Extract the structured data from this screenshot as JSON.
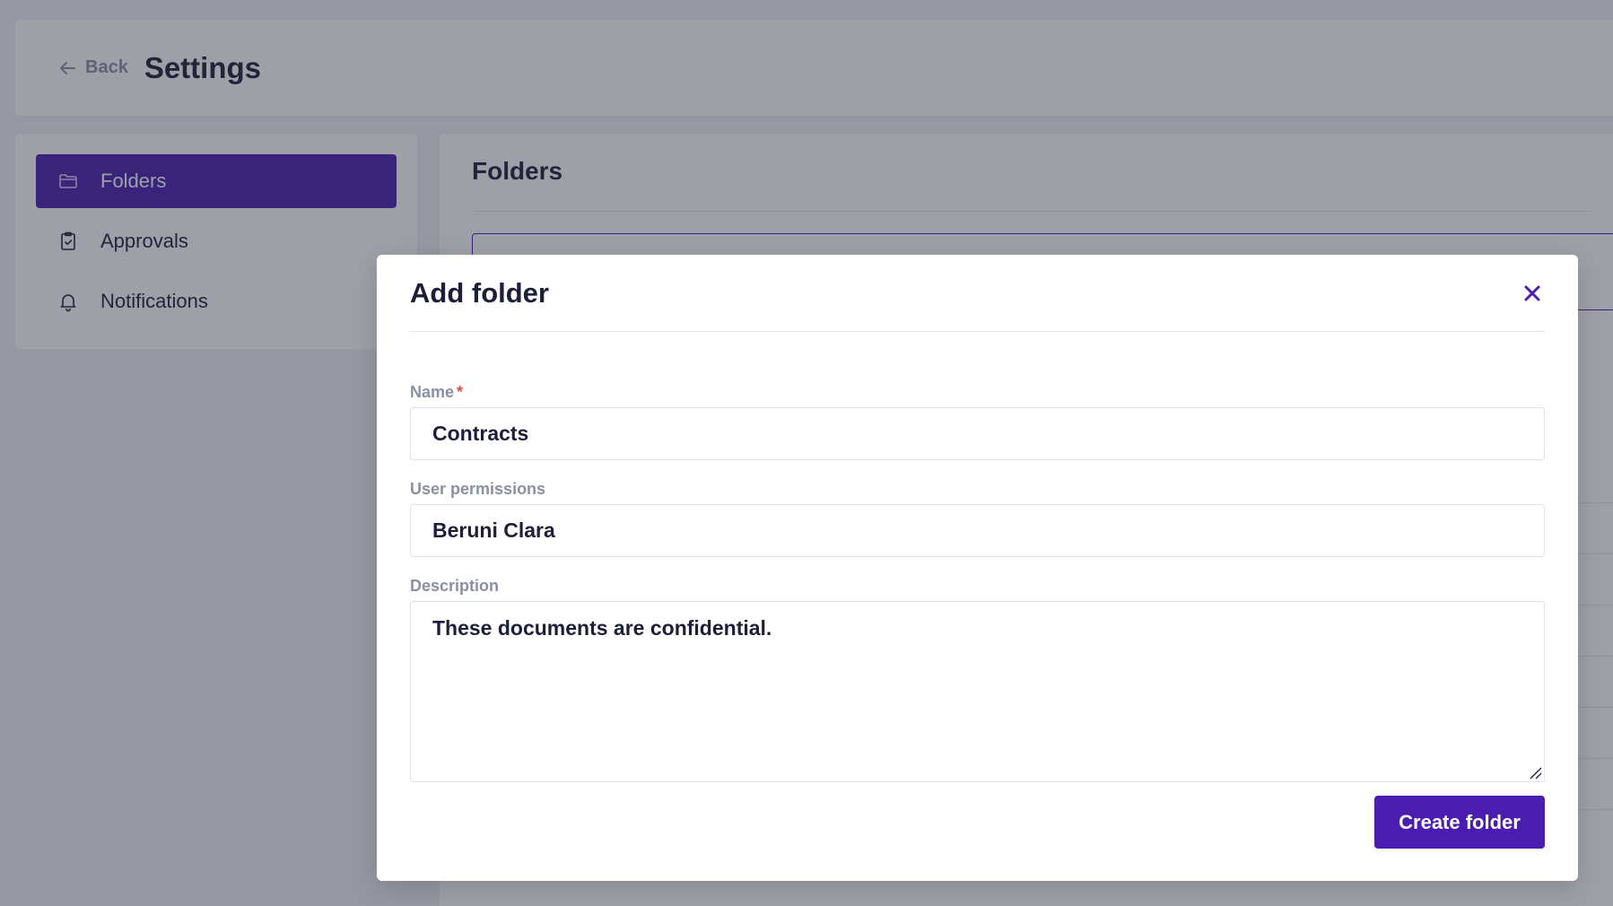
{
  "header": {
    "back_label": "Back",
    "title": "Settings"
  },
  "sidebar": {
    "items": [
      {
        "label": "Folders",
        "icon": "folder-icon",
        "active": true
      },
      {
        "label": "Approvals",
        "icon": "clipboard-check-icon",
        "active": false
      },
      {
        "label": "Notifications",
        "icon": "bell-icon",
        "active": false
      }
    ]
  },
  "main": {
    "title": "Folders"
  },
  "modal": {
    "title": "Add folder",
    "close_icon": "close-icon",
    "fields": {
      "name": {
        "label": "Name",
        "required_mark": "*",
        "value": "Contracts"
      },
      "permissions": {
        "label": "User permissions",
        "value": "Beruni Clara"
      },
      "description": {
        "label": "Description",
        "value": "These documents are confidential."
      }
    },
    "submit_label": "Create folder"
  },
  "colors": {
    "accent": "#4a1cb0",
    "required": "#e0483c",
    "muted_text": "#8a8fa3"
  }
}
